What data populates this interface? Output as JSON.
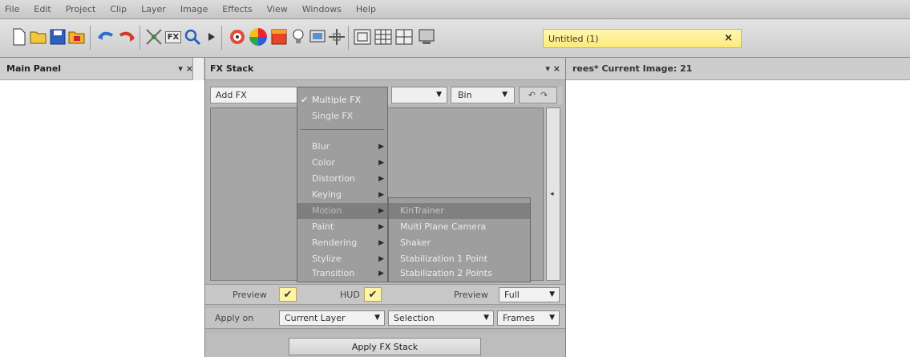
{
  "menubar": [
    "File",
    "Edit",
    "Project",
    "Clip",
    "Layer",
    "Image",
    "Effects",
    "View",
    "Windows",
    "Help"
  ],
  "toolbar": {
    "icons": [
      "new-icon",
      "open-icon",
      "save-icon",
      "export-icon",
      "undo-icon",
      "redo-icon",
      "tracker-icon",
      "fx-icon",
      "zoom-icon",
      "play-icon",
      "layers-icon",
      "color-wheel-icon",
      "square-color-icon",
      "bulb-icon",
      "monitor-icon",
      "crosshair-icon",
      "frame-icon",
      "grid-icon",
      "split-view-icon",
      "screen-icon"
    ],
    "fx_label": "FX",
    "document_tab": "Untitled (1)",
    "document_close": "×"
  },
  "main_panel": {
    "title": "Main Panel",
    "controls": "▾ ×"
  },
  "viewer": {
    "title": "rees* Current Image: 21"
  },
  "fx_stack": {
    "title": "FX Stack",
    "controls": "▾ ×",
    "add_fx_label": "Add FX",
    "bin_label": "Bin",
    "preview_label": "Preview",
    "hud_label": "HUD",
    "preview_select_label": "Preview",
    "preview_select_value": "Full",
    "apply_on_label": "Apply on",
    "apply_on_value": "Current Layer",
    "selection_value": "Selection",
    "frames_value": "Frames",
    "apply_button": "Apply FX Stack"
  },
  "add_fx_menu": {
    "top_items": [
      {
        "label": "Multiple FX",
        "checked": true
      },
      {
        "label": "Single FX",
        "checked": false
      }
    ],
    "categories": [
      "Blur",
      "Color",
      "Distortion",
      "Keying",
      "Motion",
      "Paint",
      "Rendering",
      "Stylize",
      "Transition"
    ],
    "highlighted": "Motion"
  },
  "motion_submenu": {
    "items": [
      "KinTrainer",
      "Multi Plane Camera",
      "Shaker",
      "Stabilization 1 Point",
      "Stabilization 2 Points"
    ],
    "highlighted": "KinTrainer"
  },
  "colors": {
    "menu_bg": "#9e9e9e",
    "tab_yellow": "#ffe97c",
    "check_yellow": "#fff4a6"
  }
}
